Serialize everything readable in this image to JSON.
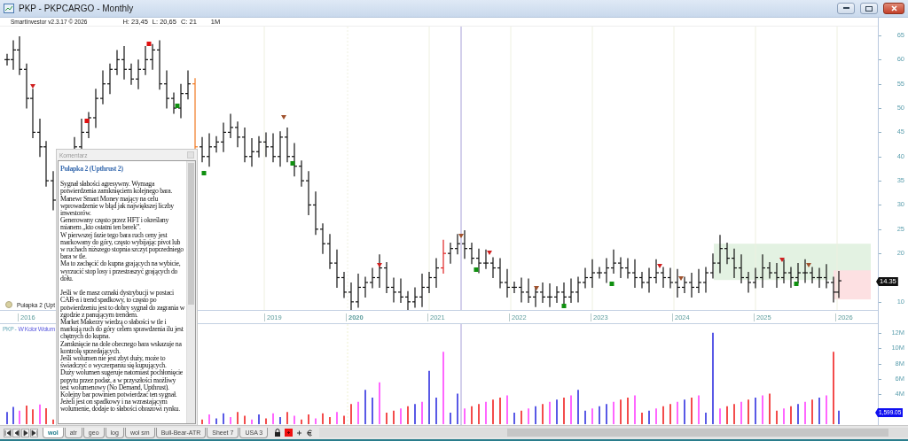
{
  "window": {
    "title": "PKP - PKPCARGO - Monthly"
  },
  "info": {
    "version": "SmartInvestor v2.3.17 © 2026",
    "high": "H: 23,45",
    "low": "L: 20,65",
    "close": "C: 21",
    "interval": "1M"
  },
  "price_panel": {
    "legend": "Pułapka 2 (Upt",
    "ticks": [
      "65",
      "60",
      "55",
      "50",
      "45",
      "40",
      "35",
      "30",
      "25",
      "20"
    ],
    "lower_ticks": [
      "10"
    ],
    "last_price": "14.35"
  },
  "years": [
    "2016",
    "2019",
    "2020",
    "2021",
    "2022",
    "2023",
    "2024",
    "2025",
    "2026"
  ],
  "volume_panel": {
    "symbol": "PKP -",
    "indicator": "W Kolor Wolum",
    "ticks": [
      "12M",
      "10M",
      "8M",
      "6M",
      "4M"
    ],
    "last_volume": "1,599.05"
  },
  "comment": {
    "header": "Komentarz",
    "title": "Pułapka 2  (Upthrust 2)",
    "paragraphs": [
      "Sygnał słabości agresywny. Wymaga potwierdzenia zamknięciem kolejnego bara.",
      "Manewr Smart Money mający na celu wprowadzenie w błąd jak największej liczby inwestorów.",
      "Generowany często przez HFT i określany mianem „kto ostatni ten berek”.",
      "W pierwszej fazie tego bara ruch ceny jest markowany do góry, często wybijając pivot lub w ruchach niższego stopnia szczyt poprzedniego bara w tle.",
      "Ma to zachęcić do kupna grających na wybicie, wyrzucić stop losy i przestraszyć grających do dołu.",
      "Jeśli w tle masz oznaki dystrybucji w postaci CAB-a i trend spadkowy, to często po potwierdzeniu jest to dobry sygnał do zagrania w zgodzie z panującym trendem.",
      "Market Makerzy wiedzą o słabości w tle i markują ruch do góry celem sprawdzenia ilu jest chętnych do kupna.",
      "Zamknięcie na dole obecnego bara wskazuje na kontrolę sprzedających.",
      "Jeśli wolumen nie jest zbyt duży, może to świadczyć o wyczerpaniu się kupujących.",
      "Duży wolumen sugeruje natomiast pochłonięcie popytu  przez podaż, a w przyszłości możliwy test wolumenowy (No Demand, Upthrust).",
      "Kolejny bar powinien potwierdzać ten sygnał.",
      "Jeżeli jest on spadkowy i na wzrastającym wolumenie, dodaje to słabości obrazowi rynku."
    ]
  },
  "sheet_tabs": [
    {
      "label": "wol",
      "selected": true
    },
    {
      "label": "atr",
      "selected": false
    },
    {
      "label": "geo",
      "selected": false
    },
    {
      "label": "log",
      "selected": false
    },
    {
      "label": "wol sm",
      "selected": false
    },
    {
      "label": "Bull-Bear-ATR",
      "selected": false
    },
    {
      "label": "Sheet 7",
      "selected": false
    },
    {
      "label": "USA 3",
      "selected": false
    }
  ]
}
